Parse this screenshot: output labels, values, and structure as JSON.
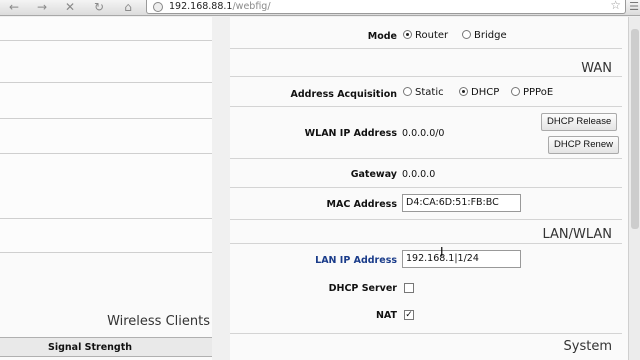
{
  "browser": {
    "url_host": "192.168.88.1",
    "url_path": "/webfig/"
  },
  "left": {
    "wireless_clients_title": "Wireless Clients",
    "signal_strength_header": "Signal Strength"
  },
  "form": {
    "mode_label": "Mode",
    "mode_options": [
      "Router",
      "Bridge"
    ],
    "mode_selected": "Router",
    "wan_section": "WAN",
    "address_acquisition_label": "Address Acquisition",
    "acquisition_options": [
      "Static",
      "DHCP",
      "PPPoE"
    ],
    "acquisition_selected": "DHCP",
    "wlan_ip_label": "WLAN IP Address",
    "wlan_ip_value": "0.0.0.0/0",
    "dhcp_release_label": "DHCP Release",
    "dhcp_renew_label": "DHCP Renew",
    "gateway_label": "Gateway",
    "gateway_value": "0.0.0.0",
    "mac_label": "MAC Address",
    "mac_value": "D4:CA:6D:51:FB:BC",
    "lan_section": "LAN/WLAN",
    "lan_ip_label": "LAN IP Address",
    "lan_ip_value": "192.168.1|1/24",
    "dhcp_server_label": "DHCP Server",
    "dhcp_server_checked": false,
    "nat_label": "NAT",
    "nat_checked": true,
    "system_section": "System"
  }
}
